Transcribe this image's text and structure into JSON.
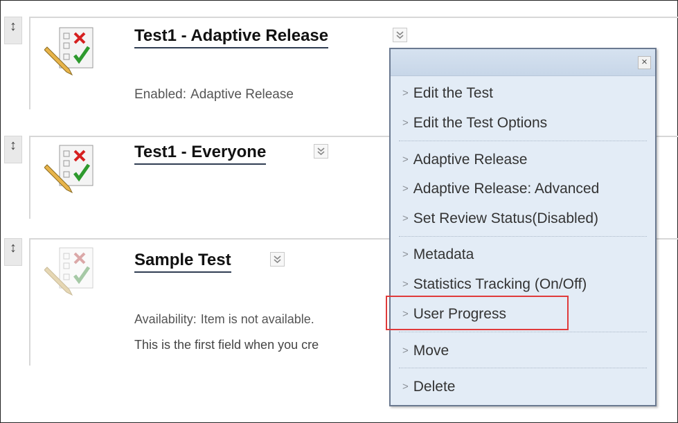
{
  "items": [
    {
      "title": "Test1 - Adaptive Release",
      "detail_label": "Enabled:",
      "detail_value": "Adaptive Release",
      "icon": "test-icon"
    },
    {
      "title": "Test1 - Everyone",
      "icon": "test-icon"
    },
    {
      "title": "Sample Test",
      "detail_label": "Availability:",
      "detail_value": "Item is not available.",
      "description": "This is the first field when you cre",
      "icon": "test-icon-faded"
    }
  ],
  "menu": {
    "close_glyph": "×",
    "arrow_glyph": ">",
    "groups": [
      [
        "Edit the Test",
        "Edit the Test Options"
      ],
      [
        "Adaptive Release",
        "Adaptive Release: Advanced",
        "Set Review Status(Disabled)"
      ],
      [
        "Metadata",
        "Statistics Tracking (On/Off)",
        "User Progress"
      ],
      [
        "Move"
      ],
      [
        "Delete"
      ]
    ],
    "highlighted_item": "User Progress",
    "highlight_color": "#e03a3a"
  },
  "handle_glyph": "↕"
}
